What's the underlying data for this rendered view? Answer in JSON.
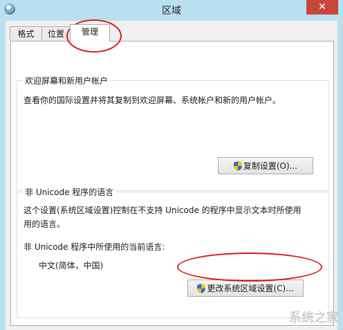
{
  "window": {
    "title": "区域",
    "close_glyph": "✕"
  },
  "tabs": [
    {
      "label": "格式",
      "active": false
    },
    {
      "label": "位置",
      "active": false
    },
    {
      "label": "管理",
      "active": true
    }
  ],
  "welcome_group": {
    "legend": "欢迎屏幕和新用户帐户",
    "description": "查看你的国际设置并将其复制到欢迎屏幕、系统帐户和新的用户帐户。",
    "copy_button": "复制设置(O)..."
  },
  "non_unicode_group": {
    "legend": "非 Unicode 程序的语言",
    "description_line1": "这个设置(系统区域设置)控制在不支持 Unicode 的程序中显示文本时所使用",
    "description_line2": "用的语言。",
    "current_label": "非 Unicode 程序中所使用的当前语言:",
    "current_value": "中文(简体，中国)",
    "change_button": "更改系统区域设置(C)..."
  },
  "watermark": "系统之家",
  "icons": {
    "app": "globe-icon",
    "shield": "uac-shield-icon",
    "close": "close-icon"
  },
  "colors": {
    "titlebar": "#b9e0f0",
    "close": "#c7463b",
    "annotation": "#e01616"
  }
}
